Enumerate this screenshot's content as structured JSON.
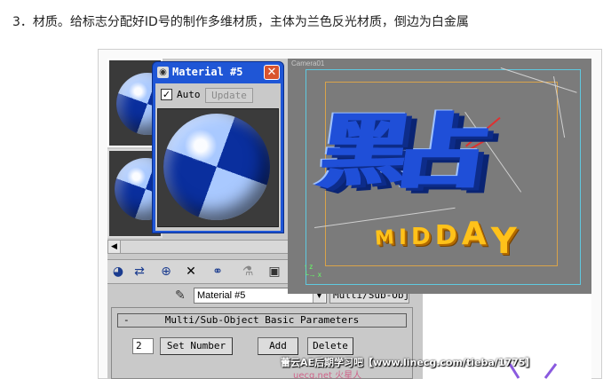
{
  "heading": "3．材质。给标志分配好ID号的制作多维材质，主体为兰色反光材质，倒边为白金属",
  "popup": {
    "title": "Material #5",
    "auto_label": "Auto",
    "update_label": "Update"
  },
  "material_row": {
    "material_name": "Material #5",
    "type_button": "Multi/Sub-Object"
  },
  "rollout": {
    "title": "Multi/Sub-Object Basic Parameters",
    "collapse_symbol": "-",
    "number_value": "2",
    "set_number_label": "Set Number",
    "add_label": "Add",
    "delete_label": "Delete"
  },
  "viewport": {
    "label": "Camera01",
    "logo_text": "點",
    "logo_letters": [
      "M",
      "I",
      "D",
      "D",
      "A",
      "Y"
    ]
  },
  "watermark": {
    "line1": "蕾云AE后期学习吧【www.linecg.com/tieba/1775】",
    "line2": "uecg.net 火星人"
  },
  "icons": [
    "get-material-icon",
    "assign-icon",
    "reset-icon",
    "delete-icon",
    "unique-icon",
    "put-library-icon",
    "effects-icon",
    "picker-icon",
    "window-icon",
    "close-icon"
  ],
  "colors": {
    "popup_title_bar": "#1f56d6",
    "close_button": "#d9542e",
    "logo_blue": "#1f4fd8",
    "logo_gold": "#ffc21a",
    "viewport_bg": "#7b7b7b"
  }
}
